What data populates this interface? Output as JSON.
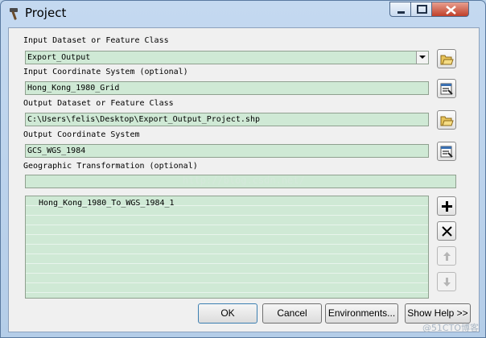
{
  "window": {
    "title": "Project",
    "icon": "hammer-icon",
    "controls": [
      "minimize-icon",
      "maximize-icon",
      "close-icon"
    ]
  },
  "form": {
    "input_dataset_label": "Input Dataset or Feature Class",
    "input_dataset_value": "Export_Output",
    "input_cs_label": "Input Coordinate System (optional)",
    "input_cs_value": "Hong_Kong_1980_Grid",
    "output_dataset_label": "Output Dataset or Feature Class",
    "output_dataset_value": "C:\\Users\\felis\\Desktop\\Export_Output_Project.shp",
    "output_cs_label": "Output Coordinate System",
    "output_cs_value": "GCS_WGS_1984",
    "geo_transform_label": "Geographic Transformation (optional)",
    "geo_transform_value": "",
    "watermark": "http://blog.csdn.net/",
    "transformations": [
      "Hong_Kong_1980_To_WGS_1984_1"
    ]
  },
  "buttons": {
    "ok": "OK",
    "cancel": "Cancel",
    "environments": "Environments...",
    "show_help": "Show Help >>"
  },
  "corner_watermark": "@51CTO博客",
  "colors": {
    "field_bg": "#cfe9d5",
    "frame": "#b9d1ea",
    "close_button": "#c0402a"
  }
}
